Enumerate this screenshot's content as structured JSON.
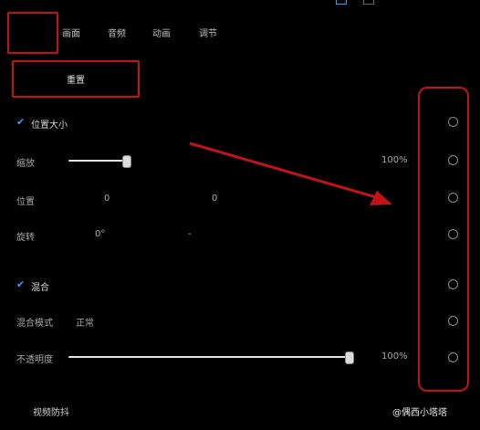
{
  "tabs": [
    "画面",
    "音频",
    "动画",
    "调节"
  ],
  "reset_button": "重置",
  "sections": {
    "position_size": {
      "title": "位置大小",
      "scale": {
        "label": "缩放",
        "value": "100%",
        "level": 1.0
      },
      "position": {
        "label": "位置",
        "x": "0",
        "y": "0"
      },
      "rotation": {
        "label": "旋转",
        "value": "0°",
        "extra": "-"
      }
    },
    "blend": {
      "title": "混合",
      "mode": {
        "label": "混合模式",
        "value": "正常"
      },
      "opacity": {
        "label": "不透明度",
        "value": "100%",
        "level": 1.0
      }
    }
  },
  "bottom": {
    "anti_shake": "视频防抖",
    "watermark": "@偶西小塔塔"
  },
  "colors": {
    "accent": "#3aa0ff",
    "annotation": "#c0141a"
  }
}
